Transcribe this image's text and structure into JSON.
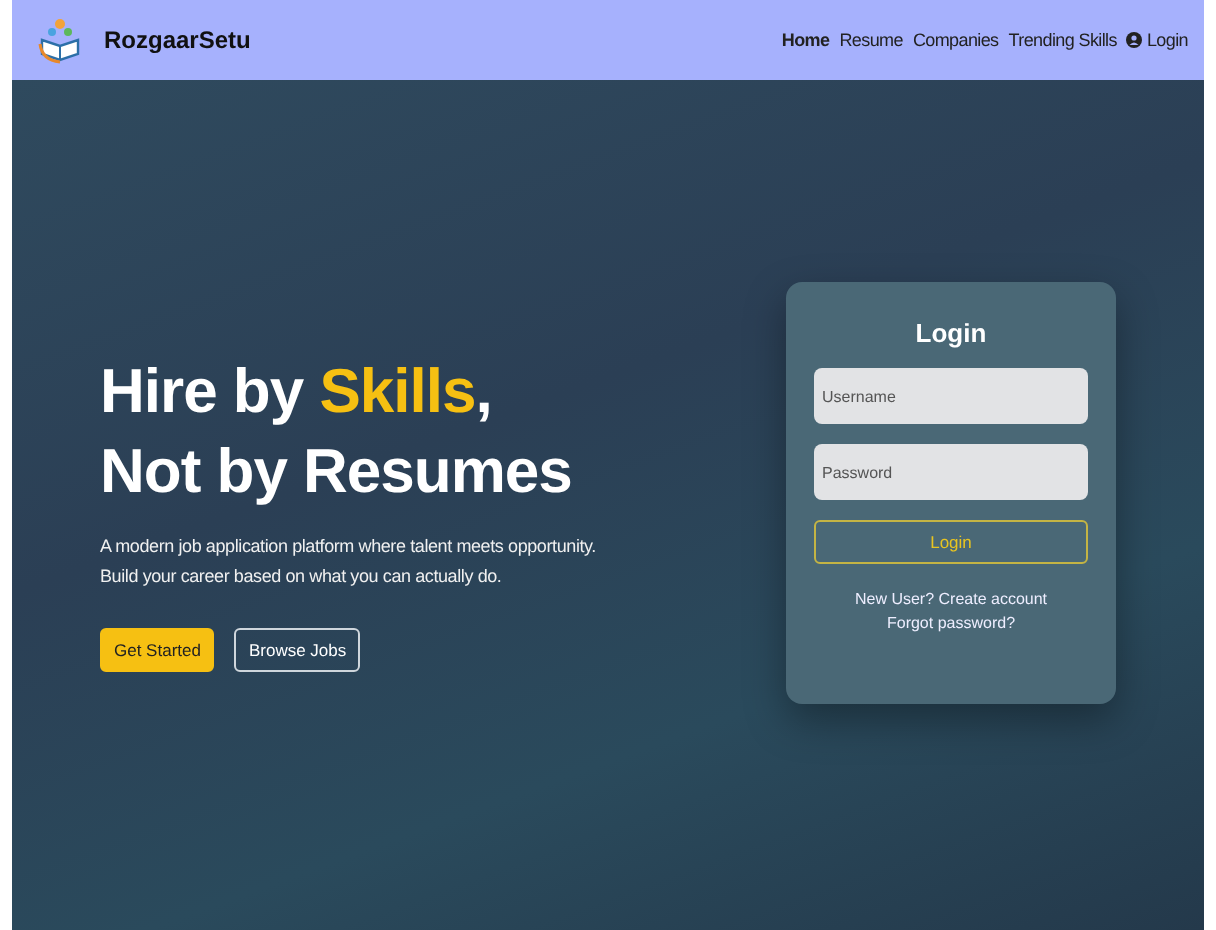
{
  "brand": {
    "name": "RozgaarSetu"
  },
  "nav": [
    {
      "label": "Home",
      "selected": true,
      "kind": "page"
    },
    {
      "label": "Resume",
      "selected": false,
      "kind": "page"
    },
    {
      "label": "Companies",
      "selected": false,
      "kind": "page"
    },
    {
      "label": "Trending Skills",
      "selected": false,
      "kind": "page"
    },
    {
      "label": "Login",
      "selected": false,
      "kind": "account"
    }
  ],
  "hero": {
    "headline_line_1": "Hire by ",
    "headline_highlight": "Skills",
    "headline_line_1_end": ",",
    "headline_line_2": "Not by Resumes",
    "description": "A modern job application platform where talent meets opportunity. Build your career based on what you can actually do.",
    "buttons": [
      {
        "label": "Get Started",
        "kind": "primary"
      },
      {
        "label": "Browse Jobs",
        "kind": "outline"
      }
    ]
  },
  "login": {
    "title": "Login",
    "fields": [
      {
        "placeholder": "Username"
      },
      {
        "placeholder": "Password"
      }
    ],
    "submit": "Login",
    "links": [
      "New User? Create account",
      "Forgot password?"
    ]
  }
}
